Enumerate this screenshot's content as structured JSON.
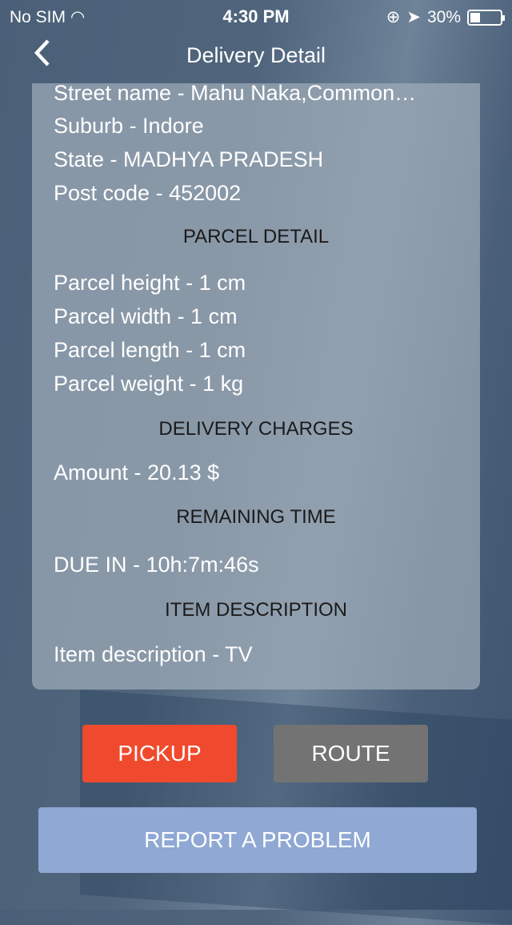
{
  "status_bar": {
    "carrier": "No SIM",
    "time": "4:30 PM",
    "battery": "30%",
    "battery_level": 0.3
  },
  "nav": {
    "title": "Delivery Detail",
    "back_icon": "chevron-left-icon"
  },
  "address": {
    "street": "Street name - Mahu Naka,Common…",
    "suburb": "Suburb - Indore",
    "state": "State - MADHYA PRADESH",
    "postcode": "Post code - 452002"
  },
  "parcel": {
    "heading": "PARCEL DETAIL",
    "height": "Parcel height - 1 cm",
    "width": "Parcel width - 1 cm",
    "length": "Parcel length - 1 cm",
    "weight": "Parcel weight - 1 kg"
  },
  "charges": {
    "heading": "DELIVERY CHARGES",
    "amount": "Amount - 20.13 $"
  },
  "remaining": {
    "heading": "REMAINING TIME",
    "due": "DUE IN - 10h:7m:46s"
  },
  "item": {
    "heading": "ITEM DESCRIPTION",
    "description": "Item description - TV"
  },
  "actions": {
    "pickup": "PICKUP",
    "route": "ROUTE",
    "report": "REPORT A PROBLEM"
  },
  "colors": {
    "pickup": "#f04a2e",
    "route": "#737373",
    "report": "#8fa8d4"
  }
}
